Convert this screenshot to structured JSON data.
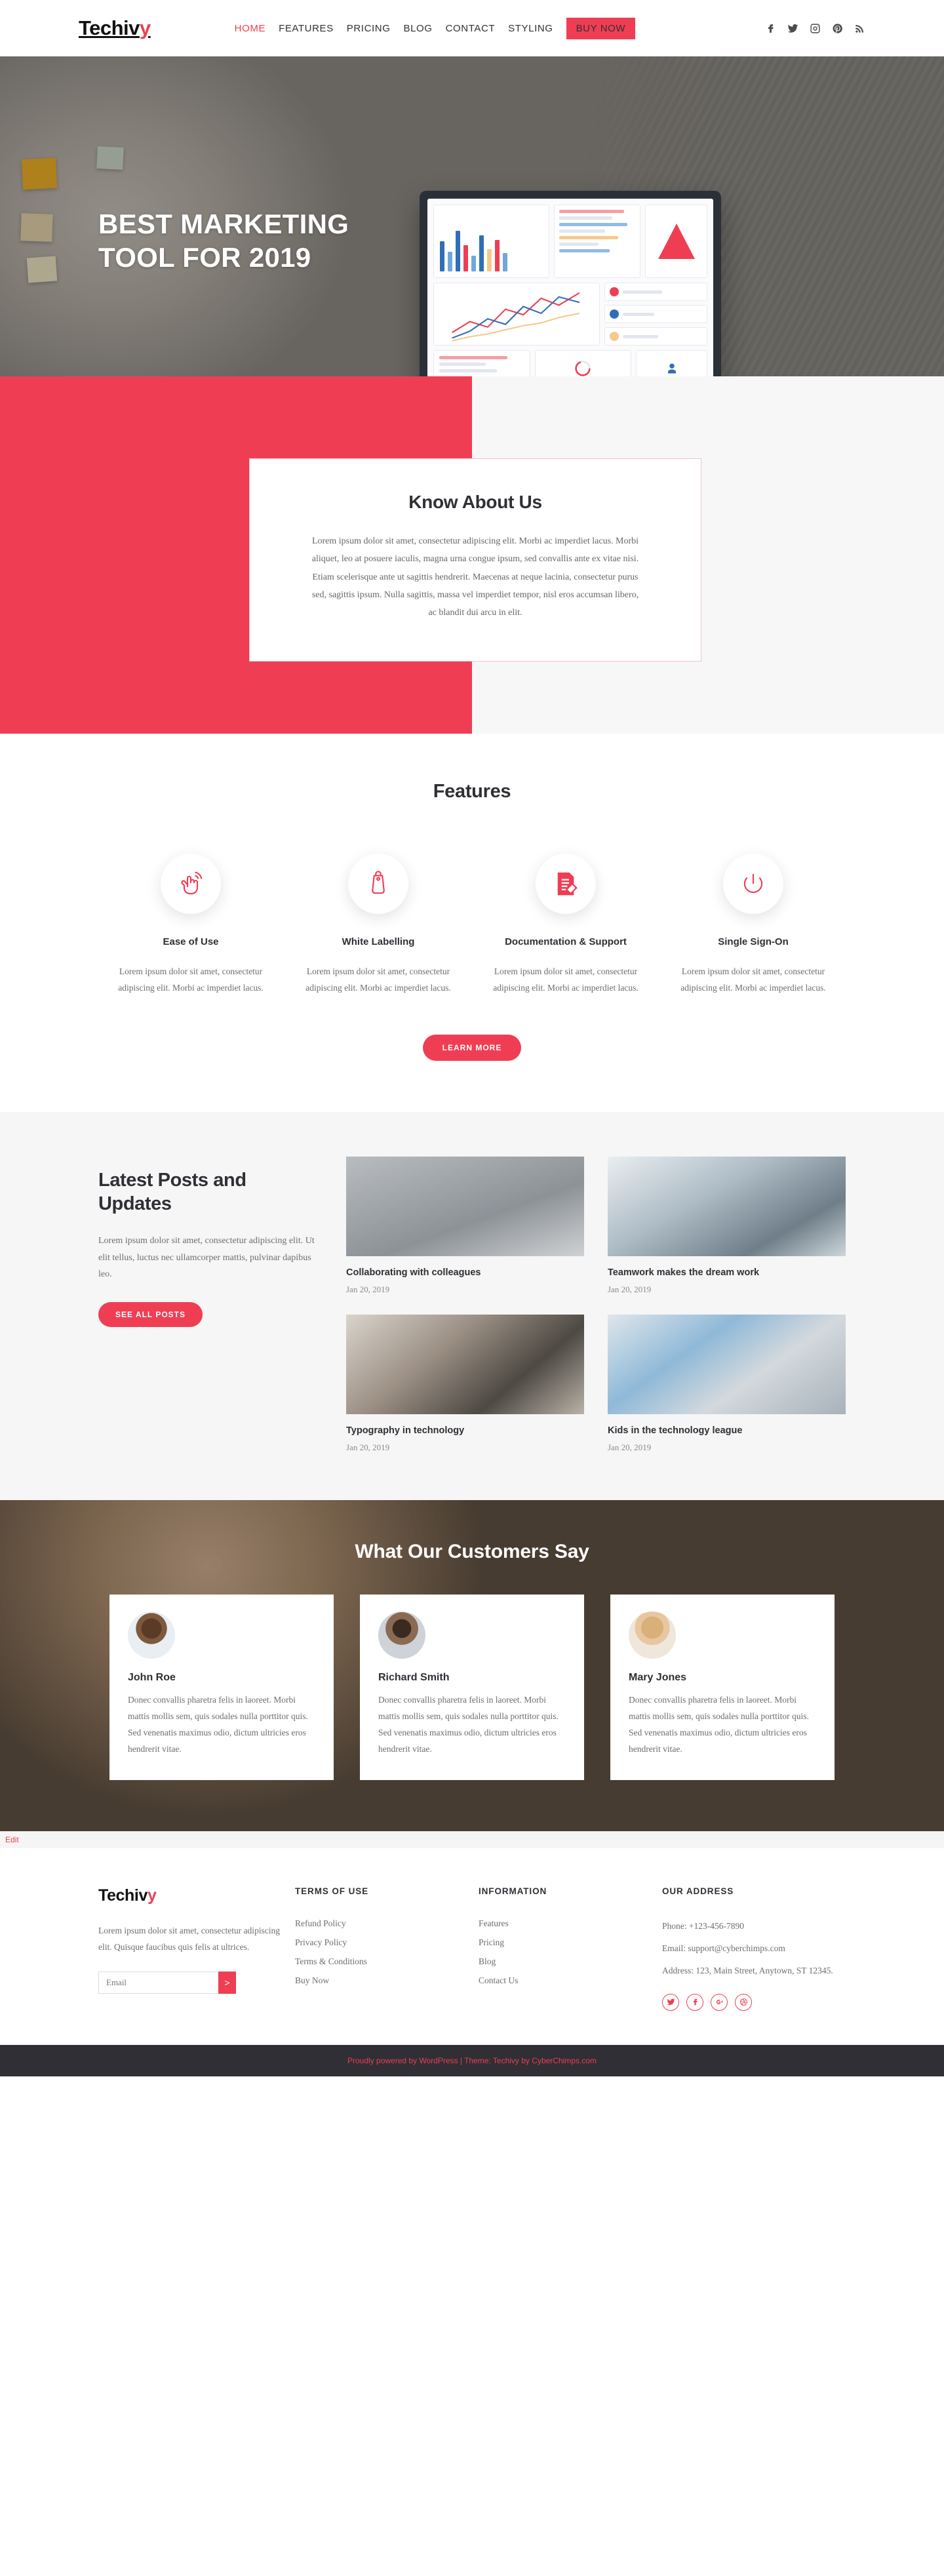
{
  "header": {
    "logo_main": "Techiv",
    "logo_accent": "y",
    "nav": [
      {
        "label": "HOME",
        "active": true
      },
      {
        "label": "FEATURES",
        "active": false
      },
      {
        "label": "PRICING",
        "active": false
      },
      {
        "label": "BLOG",
        "active": false
      },
      {
        "label": "CONTACT",
        "active": false
      },
      {
        "label": "STYLING",
        "active": false
      }
    ],
    "buy_now": "BUY NOW",
    "social": [
      "facebook-icon",
      "twitter-icon",
      "instagram-icon",
      "pinterest-icon",
      "rss-icon"
    ]
  },
  "hero": {
    "title_line1": "BEST MARKETING",
    "title_line2": "TOOL FOR 2019"
  },
  "about": {
    "heading": "Know About Us",
    "body": "Lorem ipsum dolor sit amet, consectetur adipiscing elit. Morbi ac imperdiet lacus. Morbi aliquet, leo at posuere iaculis, magna urna congue ipsum, sed convallis ante ex vitae nisi. Etiam scelerisque ante ut sagittis hendrerit. Maecenas at neque lacinia, consectetur purus sed, sagittis ipsum. Nulla sagittis, massa vel imperdiet tempor, nisl eros accumsan libero, ac blandit dui arcu in elit."
  },
  "features": {
    "heading": "Features",
    "items": [
      {
        "icon": "tap-hand-icon",
        "title": "Ease of Use",
        "text": "Lorem ipsum dolor sit amet, consectetur adipiscing elit. Morbi ac imperdiet lacus."
      },
      {
        "icon": "tag-label-icon",
        "title": "White Labelling",
        "text": "Lorem ipsum dolor sit amet, consectetur adipiscing elit. Morbi ac imperdiet lacus."
      },
      {
        "icon": "document-pen-icon",
        "title": "Documentation & Support",
        "text": "Lorem ipsum dolor sit amet, consectetur adipiscing elit. Morbi ac imperdiet lacus."
      },
      {
        "icon": "power-icon",
        "title": "Single Sign-On",
        "text": "Lorem ipsum dolor sit amet, consectetur adipiscing elit. Morbi ac imperdiet lacus."
      }
    ],
    "cta": "LEARN MORE"
  },
  "blog": {
    "heading": "Latest Posts and Updates",
    "text": "Lorem ipsum dolor sit amet, consectetur adipiscing elit. Ut elit tellus, luctus nec ullamcorper mattis, pulvinar dapibus leo.",
    "cta": "SEE ALL POSTS",
    "posts": [
      {
        "title": "Collaborating with colleagues",
        "date": "Jan 20, 2019",
        "thumb": "p1"
      },
      {
        "title": "Teamwork makes the dream work",
        "date": "Jan 20, 2019",
        "thumb": "p2"
      },
      {
        "title": "Typography in technology",
        "date": "Jan 20, 2019",
        "thumb": "p3"
      },
      {
        "title": "Kids in the technology league",
        "date": "Jan 20, 2019",
        "thumb": "p4"
      }
    ]
  },
  "testimonials": {
    "heading": "What Our Customers Say",
    "items": [
      {
        "name": "John Roe",
        "quote": "Donec convallis pharetra felis in laoreet. Morbi mattis mollis sem, quis sodales nulla porttitor quis. Sed venenatis maximus odio, dictum ultricies eros hendrerit vitae."
      },
      {
        "name": "Richard Smith",
        "quote": "Donec convallis pharetra felis in laoreet. Morbi mattis mollis sem, quis sodales nulla porttitor quis. Sed venenatis maximus odio, dictum ultricies eros hendrerit vitae."
      },
      {
        "name": "Mary Jones",
        "quote": "Donec convallis pharetra felis in laoreet. Morbi mattis mollis sem, quis sodales nulla porttitor quis. Sed venenatis maximus odio, dictum ultricies eros hendrerit vitae."
      }
    ]
  },
  "edit_bar": {
    "label": "Edit"
  },
  "footer": {
    "logo_main": "Techiv",
    "logo_accent": "y",
    "brand_text": "Lorem ipsum dolor sit amet, consectetur adipiscing elit. Quisque faucibus quis felis at ultrices.",
    "newsletter": {
      "placeholder": "Email",
      "button": ">"
    },
    "terms": {
      "heading": "TERMS OF USE",
      "links": [
        "Refund Policy",
        "Privacy Policy",
        "Terms & Conditions",
        "Buy Now"
      ]
    },
    "information": {
      "heading": "INFORMATION",
      "links": [
        "Features",
        "Pricing",
        "Blog",
        "Contact Us"
      ]
    },
    "address": {
      "heading": "OUR ADDRESS",
      "phone": "Phone: +123-456-7890",
      "email": "Email: support@cyberchimps.com",
      "address": "Address: 123, Main Street, Anytown, ST 12345."
    },
    "social": [
      "twitter-icon",
      "facebook-icon",
      "google-plus-icon",
      "dribbble-icon"
    ]
  },
  "bottom": {
    "text_pre": "Proudly powered by ",
    "link1": "WordPress",
    "text_mid": " | Theme: Techivy by ",
    "link2": "CyberChimps.com"
  },
  "colors": {
    "accent": "#ef3e53",
    "dark": "#2f2f35",
    "muted": "#6d6d74"
  }
}
